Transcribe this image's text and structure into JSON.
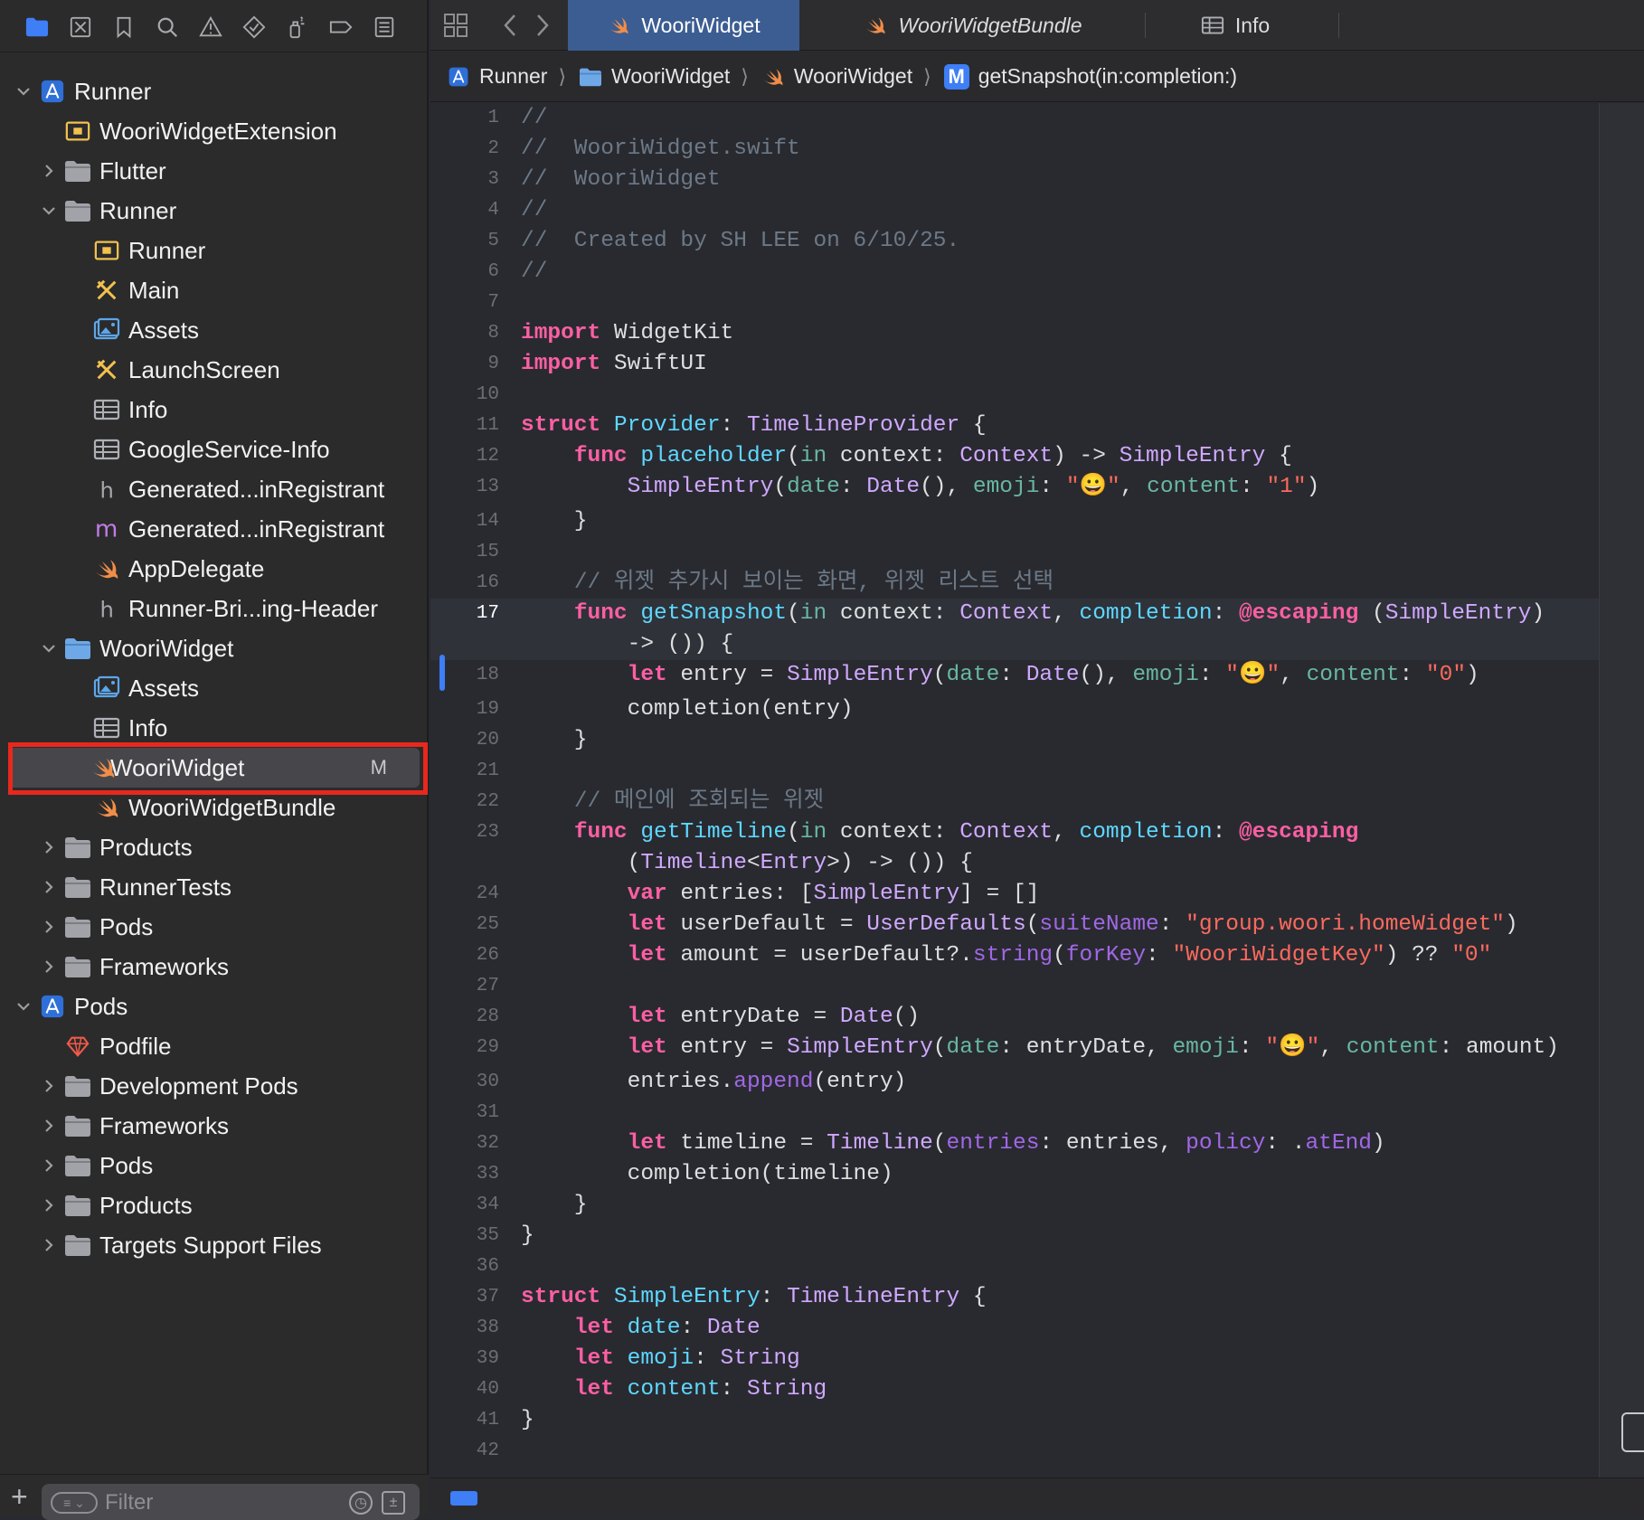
{
  "colors": {
    "accent": "#3e7ef7",
    "selection_box": "#e8281d",
    "active_tab": "#3c5d92",
    "swift_orange": "#f08d49",
    "folder_blue": "#6fa8e6"
  },
  "navigator_toolbar": [
    {
      "name": "project-navigator-icon",
      "icon": "folder"
    },
    {
      "name": "source-control-icon",
      "icon": "x-square"
    },
    {
      "name": "bookmark-icon",
      "icon": "bookmark"
    },
    {
      "name": "find-icon",
      "icon": "search"
    },
    {
      "name": "issue-icon",
      "icon": "warning"
    },
    {
      "name": "test-icon",
      "icon": "diamond"
    },
    {
      "name": "debug-icon",
      "icon": "spray"
    },
    {
      "name": "breakpoint-icon",
      "icon": "tag"
    },
    {
      "name": "report-icon",
      "icon": "list"
    }
  ],
  "tree": [
    {
      "label": "Runner",
      "depth": 0,
      "disclosure": "open",
      "icon": "project"
    },
    {
      "label": "WooriWidgetExtension",
      "depth": 1,
      "disclosure": "none",
      "icon": "app-ext"
    },
    {
      "label": "Flutter",
      "depth": 1,
      "disclosure": "closed",
      "icon": "folder-gray"
    },
    {
      "label": "Runner",
      "depth": 1,
      "disclosure": "open",
      "icon": "folder-gray"
    },
    {
      "label": "Runner",
      "depth": 2,
      "disclosure": "none",
      "icon": "app-ext"
    },
    {
      "label": "Main",
      "depth": 2,
      "disclosure": "none",
      "icon": "storyboard"
    },
    {
      "label": "Assets",
      "depth": 2,
      "disclosure": "none",
      "icon": "assets"
    },
    {
      "label": "LaunchScreen",
      "depth": 2,
      "disclosure": "none",
      "icon": "storyboard"
    },
    {
      "label": "Info",
      "depth": 2,
      "disclosure": "none",
      "icon": "plist"
    },
    {
      "label": "GoogleService-Info",
      "depth": 2,
      "disclosure": "none",
      "icon": "plist"
    },
    {
      "label": "Generated...inRegistrant",
      "depth": 2,
      "disclosure": "none",
      "icon": "header-h"
    },
    {
      "label": "Generated...inRegistrant",
      "depth": 2,
      "disclosure": "none",
      "icon": "objc-m"
    },
    {
      "label": "AppDelegate",
      "depth": 2,
      "disclosure": "none",
      "icon": "swift"
    },
    {
      "label": "Runner-Bri...ing-Header",
      "depth": 2,
      "disclosure": "none",
      "icon": "header-h"
    },
    {
      "label": "WooriWidget",
      "depth": 1,
      "disclosure": "open",
      "icon": "folder-blue"
    },
    {
      "label": "Assets",
      "depth": 2,
      "disclosure": "none",
      "icon": "assets"
    },
    {
      "label": "Info",
      "depth": 2,
      "disclosure": "none",
      "icon": "plist"
    },
    {
      "label": "WooriWidget",
      "depth": 2,
      "disclosure": "none",
      "icon": "swift",
      "selected": true,
      "badge": "M"
    },
    {
      "label": "WooriWidgetBundle",
      "depth": 2,
      "disclosure": "none",
      "icon": "swift"
    },
    {
      "label": "Products",
      "depth": 1,
      "disclosure": "closed",
      "icon": "folder-gray"
    },
    {
      "label": "RunnerTests",
      "depth": 1,
      "disclosure": "closed",
      "icon": "folder-gray"
    },
    {
      "label": "Pods",
      "depth": 1,
      "disclosure": "closed",
      "icon": "folder-gray"
    },
    {
      "label": "Frameworks",
      "depth": 1,
      "disclosure": "closed",
      "icon": "folder-gray"
    },
    {
      "label": "Pods",
      "depth": 0,
      "disclosure": "open",
      "icon": "project"
    },
    {
      "label": "Podfile",
      "depth": 1,
      "disclosure": "none",
      "icon": "ruby"
    },
    {
      "label": "Development Pods",
      "depth": 1,
      "disclosure": "closed",
      "icon": "folder-gray"
    },
    {
      "label": "Frameworks",
      "depth": 1,
      "disclosure": "closed",
      "icon": "folder-gray"
    },
    {
      "label": "Pods",
      "depth": 1,
      "disclosure": "closed",
      "icon": "folder-gray"
    },
    {
      "label": "Products",
      "depth": 1,
      "disclosure": "closed",
      "icon": "folder-gray"
    },
    {
      "label": "Targets Support Files",
      "depth": 1,
      "disclosure": "closed",
      "icon": "folder-gray"
    }
  ],
  "filter": {
    "placeholder": "Filter",
    "add_label": "+"
  },
  "tabs": [
    {
      "label": "WooriWidget",
      "icon": "swift",
      "active": true,
      "italic": false
    },
    {
      "label": "WooriWidgetBundle",
      "icon": "swift",
      "active": false,
      "italic": true
    },
    {
      "label": "Info",
      "icon": "plist",
      "active": false,
      "italic": false
    }
  ],
  "breadcrumbs": [
    {
      "label": "Runner",
      "icon": "project"
    },
    {
      "label": "WooriWidget",
      "icon": "folder-blue"
    },
    {
      "label": "WooriWidget",
      "icon": "swift"
    },
    {
      "label": "getSnapshot(in:completion:)",
      "icon": "method-m"
    }
  ],
  "editor": {
    "current_line": 17,
    "changed_line": 18,
    "lines": [
      {
        "n": "1",
        "t": [
          [
            "cm",
            "//"
          ]
        ]
      },
      {
        "n": "2",
        "t": [
          [
            "cm",
            "//  WooriWidget.swift"
          ]
        ]
      },
      {
        "n": "3",
        "t": [
          [
            "cm",
            "//  WooriWidget"
          ]
        ]
      },
      {
        "n": "4",
        "t": [
          [
            "cm",
            "//"
          ]
        ]
      },
      {
        "n": "5",
        "t": [
          [
            "cm",
            "//  Created by SH LEE on 6/10/25."
          ]
        ]
      },
      {
        "n": "6",
        "t": [
          [
            "cm",
            "//"
          ]
        ]
      },
      {
        "n": "7",
        "t": []
      },
      {
        "n": "8",
        "t": [
          [
            "kw",
            "import"
          ],
          [
            "",
            " WidgetKit"
          ]
        ]
      },
      {
        "n": "9",
        "t": [
          [
            "kw",
            "import"
          ],
          [
            "",
            " SwiftUI"
          ]
        ]
      },
      {
        "n": "10",
        "t": []
      },
      {
        "n": "11",
        "t": [
          [
            "kw",
            "struct"
          ],
          [
            "",
            " "
          ],
          [
            "pt",
            "Provider"
          ],
          [
            "",
            ": "
          ],
          [
            "ty",
            "TimelineProvider"
          ],
          [
            "",
            " {"
          ]
        ]
      },
      {
        "n": "12",
        "t": [
          [
            "",
            "    "
          ],
          [
            "kw",
            "func"
          ],
          [
            "",
            " "
          ],
          [
            "pt",
            "placeholder"
          ],
          [
            "",
            "("
          ],
          [
            "fn",
            "in"
          ],
          [
            "",
            " context: "
          ],
          [
            "ty",
            "Context"
          ],
          [
            "",
            ") -> "
          ],
          [
            "ty",
            "SimpleEntry"
          ],
          [
            "",
            " {"
          ]
        ]
      },
      {
        "n": "13",
        "t": [
          [
            "",
            "        "
          ],
          [
            "ty",
            "SimpleEntry"
          ],
          [
            "",
            "("
          ],
          [
            "fn",
            "date"
          ],
          [
            "",
            ": "
          ],
          [
            "ty",
            "Date"
          ],
          [
            "",
            "(), "
          ],
          [
            "fn",
            "emoji"
          ],
          [
            "",
            ": "
          ],
          [
            "st",
            "\""
          ],
          [
            "em",
            "😀"
          ],
          [
            "st",
            "\""
          ],
          [
            "",
            ", "
          ],
          [
            "fn",
            "content"
          ],
          [
            "",
            ": "
          ],
          [
            "st",
            "\"1\""
          ],
          [
            "",
            ")"
          ]
        ]
      },
      {
        "n": "14",
        "t": [
          [
            "",
            "    }"
          ]
        ]
      },
      {
        "n": "15",
        "t": []
      },
      {
        "n": "16",
        "t": [
          [
            "",
            "    "
          ],
          [
            "cm",
            "// 위젯 추가시 보이는 화면, 위젯 리스트 선택"
          ]
        ]
      },
      {
        "n": "17",
        "t": [
          [
            "",
            "    "
          ],
          [
            "kw",
            "func"
          ],
          [
            "",
            " "
          ],
          [
            "pt",
            "getSnapshot"
          ],
          [
            "",
            "("
          ],
          [
            "fn",
            "in"
          ],
          [
            "",
            " context: "
          ],
          [
            "ty",
            "Context"
          ],
          [
            "",
            ", "
          ],
          [
            "pt",
            "completion"
          ],
          [
            "",
            ": "
          ],
          [
            "at",
            "@escaping"
          ],
          [
            "",
            " ("
          ],
          [
            "ty",
            "SimpleEntry"
          ],
          [
            "",
            ")"
          ]
        ],
        "wrap": [
          [
            "",
            "        -> ()) {"
          ]
        ]
      },
      {
        "n": "18",
        "t": [
          [
            "",
            "        "
          ],
          [
            "kw",
            "let"
          ],
          [
            "",
            " entry = "
          ],
          [
            "ty",
            "SimpleEntry"
          ],
          [
            "",
            "("
          ],
          [
            "fn",
            "date"
          ],
          [
            "",
            ": "
          ],
          [
            "ty",
            "Date"
          ],
          [
            "",
            "(), "
          ],
          [
            "fn",
            "emoji"
          ],
          [
            "",
            ": "
          ],
          [
            "st",
            "\""
          ],
          [
            "em",
            "😀"
          ],
          [
            "st",
            "\""
          ],
          [
            "",
            ", "
          ],
          [
            "fn",
            "content"
          ],
          [
            "",
            ": "
          ],
          [
            "st",
            "\"0\""
          ],
          [
            "",
            ")"
          ]
        ]
      },
      {
        "n": "19",
        "t": [
          [
            "",
            "        completion(entry)"
          ]
        ]
      },
      {
        "n": "20",
        "t": [
          [
            "",
            "    }"
          ]
        ]
      },
      {
        "n": "21",
        "t": []
      },
      {
        "n": "22",
        "t": [
          [
            "",
            "    "
          ],
          [
            "cm",
            "// 메인에 조회되는 위젯"
          ]
        ]
      },
      {
        "n": "23",
        "t": [
          [
            "",
            "    "
          ],
          [
            "kw",
            "func"
          ],
          [
            "",
            " "
          ],
          [
            "pt",
            "getTimeline"
          ],
          [
            "",
            "("
          ],
          [
            "fn",
            "in"
          ],
          [
            "",
            " context: "
          ],
          [
            "ty",
            "Context"
          ],
          [
            "",
            ", "
          ],
          [
            "pt",
            "completion"
          ],
          [
            "",
            ": "
          ],
          [
            "at",
            "@escaping"
          ]
        ],
        "wrap": [
          [
            "",
            "        ("
          ],
          [
            "ty",
            "Timeline"
          ],
          [
            "",
            "<"
          ],
          [
            "ty",
            "Entry"
          ],
          [
            "",
            ">) -> ()) {"
          ]
        ]
      },
      {
        "n": "24",
        "t": [
          [
            "",
            "        "
          ],
          [
            "kw",
            "var"
          ],
          [
            "",
            " entries: ["
          ],
          [
            "ty",
            "SimpleEntry"
          ],
          [
            "",
            "] = []"
          ]
        ]
      },
      {
        "n": "25",
        "t": [
          [
            "",
            "        "
          ],
          [
            "kw",
            "let"
          ],
          [
            "",
            " userDefault = "
          ],
          [
            "ty",
            "UserDefaults"
          ],
          [
            "",
            "("
          ],
          [
            "tp",
            "suiteName"
          ],
          [
            "",
            ": "
          ],
          [
            "st",
            "\"group.woori.homeWidget\""
          ],
          [
            "",
            ")"
          ]
        ]
      },
      {
        "n": "26",
        "t": [
          [
            "",
            "        "
          ],
          [
            "kw",
            "let"
          ],
          [
            "",
            " amount = userDefault?."
          ],
          [
            "tp",
            "string"
          ],
          [
            "",
            "("
          ],
          [
            "tp",
            "forKey"
          ],
          [
            "",
            ": "
          ],
          [
            "st",
            "\"WooriWidgetKey\""
          ],
          [
            "",
            ") ?? "
          ],
          [
            "st",
            "\"0\""
          ]
        ]
      },
      {
        "n": "27",
        "t": []
      },
      {
        "n": "28",
        "t": [
          [
            "",
            "        "
          ],
          [
            "kw",
            "let"
          ],
          [
            "",
            " entryDate = "
          ],
          [
            "ty",
            "Date"
          ],
          [
            "",
            "()"
          ]
        ]
      },
      {
        "n": "29",
        "t": [
          [
            "",
            "        "
          ],
          [
            "kw",
            "let"
          ],
          [
            "",
            " entry = "
          ],
          [
            "ty",
            "SimpleEntry"
          ],
          [
            "",
            "("
          ],
          [
            "fn",
            "date"
          ],
          [
            "",
            ": entryDate, "
          ],
          [
            "fn",
            "emoji"
          ],
          [
            "",
            ": "
          ],
          [
            "st",
            "\""
          ],
          [
            "em",
            "😀"
          ],
          [
            "st",
            "\""
          ],
          [
            "",
            ", "
          ],
          [
            "fn",
            "content"
          ],
          [
            "",
            ": amount)"
          ]
        ]
      },
      {
        "n": "30",
        "t": [
          [
            "",
            "        entries."
          ],
          [
            "tp",
            "append"
          ],
          [
            "",
            "(entry)"
          ]
        ]
      },
      {
        "n": "31",
        "t": []
      },
      {
        "n": "32",
        "t": [
          [
            "",
            "        "
          ],
          [
            "kw",
            "let"
          ],
          [
            "",
            " timeline = "
          ],
          [
            "ty",
            "Timeline"
          ],
          [
            "",
            "("
          ],
          [
            "tp",
            "entries"
          ],
          [
            "",
            ": entries, "
          ],
          [
            "tp",
            "policy"
          ],
          [
            "",
            ": ."
          ],
          [
            "tp",
            "atEnd"
          ],
          [
            "",
            ")"
          ]
        ]
      },
      {
        "n": "33",
        "t": [
          [
            "",
            "        completion(timeline)"
          ]
        ]
      },
      {
        "n": "34",
        "t": [
          [
            "",
            "    }"
          ]
        ]
      },
      {
        "n": "35",
        "t": [
          [
            "",
            "}"
          ]
        ]
      },
      {
        "n": "36",
        "t": []
      },
      {
        "n": "37",
        "t": [
          [
            "kw",
            "struct"
          ],
          [
            "",
            " "
          ],
          [
            "pt",
            "SimpleEntry"
          ],
          [
            "",
            ": "
          ],
          [
            "ty",
            "TimelineEntry"
          ],
          [
            "",
            " {"
          ]
        ]
      },
      {
        "n": "38",
        "t": [
          [
            "",
            "    "
          ],
          [
            "kw",
            "let"
          ],
          [
            "",
            " "
          ],
          [
            "pt",
            "date"
          ],
          [
            "",
            ": "
          ],
          [
            "ty",
            "Date"
          ]
        ]
      },
      {
        "n": "39",
        "t": [
          [
            "",
            "    "
          ],
          [
            "kw",
            "let"
          ],
          [
            "",
            " "
          ],
          [
            "pt",
            "emoji"
          ],
          [
            "",
            ": "
          ],
          [
            "ty",
            "String"
          ]
        ]
      },
      {
        "n": "40",
        "t": [
          [
            "",
            "    "
          ],
          [
            "kw",
            "let"
          ],
          [
            "",
            " "
          ],
          [
            "pt",
            "content"
          ],
          [
            "",
            ": "
          ],
          [
            "ty",
            "String"
          ]
        ]
      },
      {
        "n": "41",
        "t": [
          [
            "",
            "}"
          ]
        ]
      },
      {
        "n": "42",
        "t": []
      }
    ]
  }
}
